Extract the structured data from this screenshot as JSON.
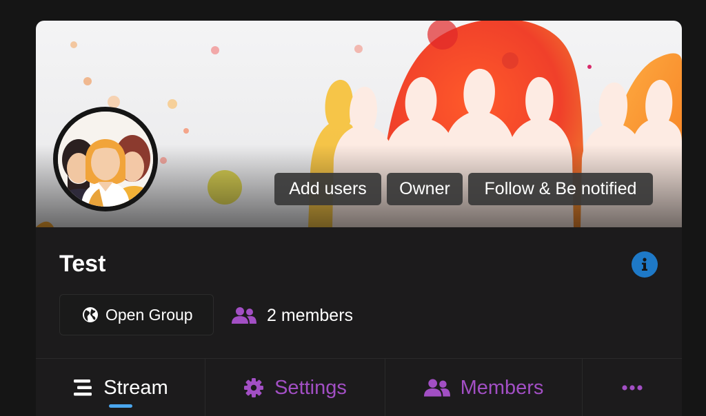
{
  "group": {
    "name": "Test",
    "type_label": "Open Group",
    "members_label": "2 members"
  },
  "actions": {
    "add_users": "Add users",
    "owner": "Owner",
    "follow": "Follow & Be notified"
  },
  "tabs": [
    {
      "label": "Stream",
      "icon": "stream-icon",
      "active": true
    },
    {
      "label": "Settings",
      "icon": "gear-icon",
      "active": false
    },
    {
      "label": "Members",
      "icon": "users-icon",
      "active": false
    },
    {
      "label": "",
      "icon": "ellipsis-icon",
      "active": false
    }
  ],
  "colors": {
    "accent_purple": "#a24fc4",
    "info_blue": "#1e79c7",
    "active_tab_indicator": "#4aa6ee",
    "background": "#151515",
    "card": "#1c1b1c"
  }
}
